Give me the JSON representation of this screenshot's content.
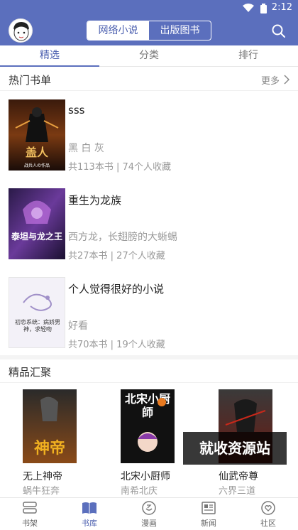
{
  "status_bar": {
    "time": "2:12"
  },
  "header": {
    "segments": [
      {
        "label": "网络小说",
        "active": true
      },
      {
        "label": "出版图书",
        "active": false
      }
    ]
  },
  "tabs": [
    {
      "label": "精选",
      "active": true
    },
    {
      "label": "分类",
      "active": false
    },
    {
      "label": "排行",
      "active": false
    }
  ],
  "hot_lists": {
    "title": "热门书单",
    "more": "更多",
    "items": [
      {
        "name": "sss",
        "desc": "黑 白 灰",
        "meta": "共113本书 | 74个人收藏"
      },
      {
        "name": "重生为龙族",
        "desc": "西方龙，长翅膀的大蜥蜴",
        "meta": "共27本书 | 27个人收藏"
      },
      {
        "name": "个人觉得很好的小说",
        "desc": "好看",
        "meta": "共70本书 | 19个人收藏"
      }
    ],
    "cover_texts": [
      {
        "main": "盖人",
        "sub": "战兵人の作品"
      },
      {
        "main": "泰坦与龙之王",
        "sub": ""
      },
      {
        "main": "初恋系统：病娇男神，求轻吻",
        "sub": ""
      }
    ]
  },
  "quality": {
    "title": "精品汇聚",
    "items": [
      {
        "name": "无上神帝",
        "author": "蜗牛狂奔",
        "cover_text": "神帝"
      },
      {
        "name": "北宋小厨师",
        "author": "南希北庆",
        "cover_text": "北宋小厨師"
      },
      {
        "name": "仙武帝尊",
        "author": "六界三道",
        "cover_text": ""
      }
    ],
    "watermark": "就收资源站"
  },
  "bottom_nav": [
    {
      "label": "书架",
      "icon": "bookshelf-icon",
      "active": false
    },
    {
      "label": "书库",
      "icon": "book-library-icon",
      "active": true
    },
    {
      "label": "漫画",
      "icon": "comic-icon",
      "active": false
    },
    {
      "label": "新闻",
      "icon": "news-icon",
      "active": false
    },
    {
      "label": "社区",
      "icon": "community-icon",
      "active": false
    }
  ],
  "colors": {
    "primary": "#5b6fbd",
    "accent": "#4b5faf"
  }
}
